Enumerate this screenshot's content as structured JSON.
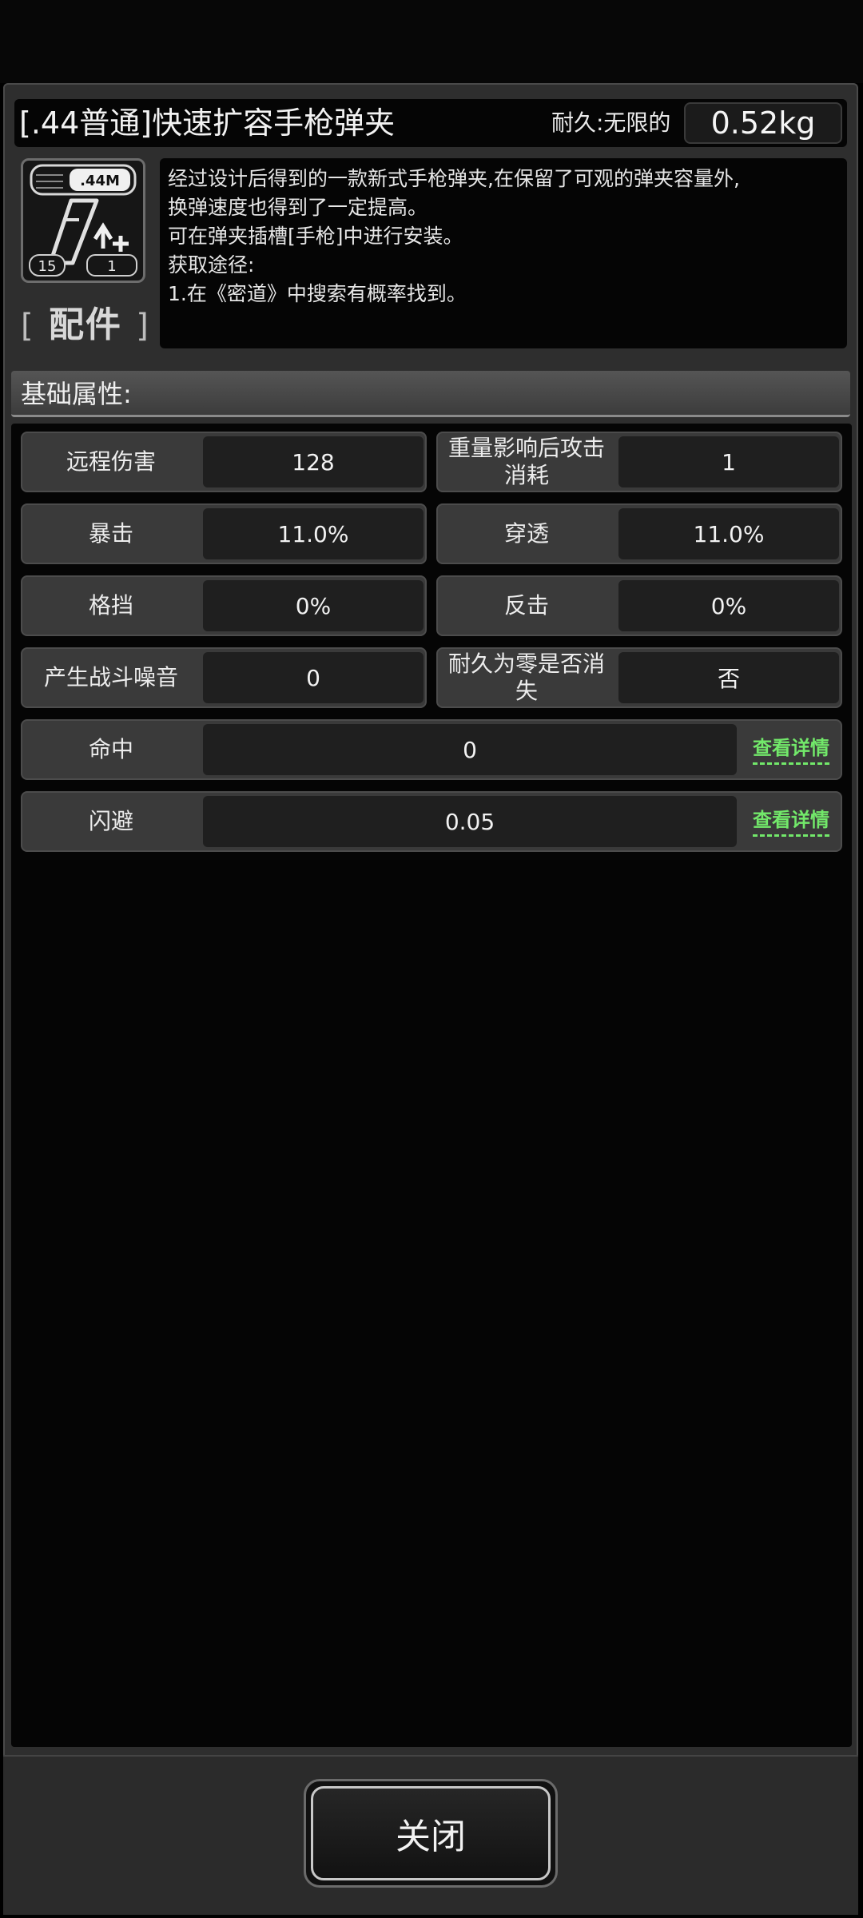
{
  "item": {
    "title": "[.44普通]快速扩容手枪弹夹",
    "durability": "耐久:无限的",
    "weight": "0.52kg",
    "icon": {
      "name": "pistol-magazine-icon",
      "badge_text": ".44M",
      "count_left": "15",
      "count_right": "1"
    },
    "category": {
      "open": "[",
      "label": "配件",
      "close": "]"
    },
    "description": [
      "经过设计后得到的一款新式手枪弹夹,在保留了可观的弹夹容量外,",
      "换弹速度也得到了一定提高。",
      "可在弹夹插槽[手枪]中进行安装。",
      "获取途径:",
      "1.在《密道》中搜索有概率找到。"
    ]
  },
  "section": {
    "title": "基础属性:"
  },
  "stats": {
    "ranged_damage": {
      "label": "远程伤害",
      "value": "128"
    },
    "attack_cost": {
      "label": "重量影响后攻击消耗",
      "value": "1"
    },
    "crit": {
      "label": "暴击",
      "value": "11.0%"
    },
    "pierce": {
      "label": "穿透",
      "value": "11.0%"
    },
    "block": {
      "label": "格挡",
      "value": "0%"
    },
    "counter": {
      "label": "反击",
      "value": "0%"
    },
    "noise": {
      "label": "产生战斗噪音",
      "value": "0"
    },
    "vanish": {
      "label": "耐久为零是否消失",
      "value": "否"
    },
    "hit": {
      "label": "命中",
      "value": "0",
      "link": "查看详情"
    },
    "dodge": {
      "label": "闪避",
      "value": "0.05",
      "link": "查看详情"
    }
  },
  "footer": {
    "close_label": "关闭"
  },
  "colors": {
    "link": "#72e86a",
    "panel": "#2e2e2e",
    "background": "#000000"
  }
}
